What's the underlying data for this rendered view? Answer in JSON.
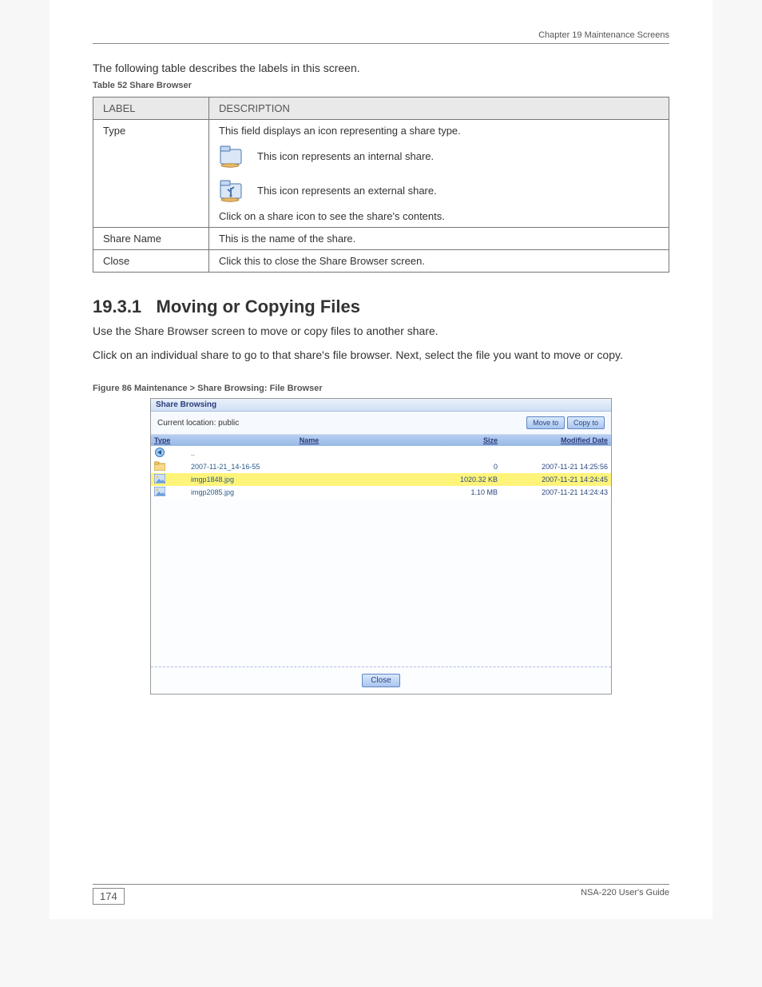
{
  "header": {
    "chapter": "Chapter 19 Maintenance Screens"
  },
  "intro_text": "The following table describes the labels in this screen.",
  "table1": {
    "caption": "Table 52   Share Browser",
    "headers": [
      "LABEL",
      "DESCRIPTION"
    ],
    "rows": [
      {
        "label": "Type",
        "desc_intro": "This field displays an icon representing a share type.",
        "icons": [
          {
            "name": "folder-share-icon",
            "text": "This icon represents an internal share."
          },
          {
            "name": "usb-folder-icon",
            "text": "This icon represents an external share."
          }
        ],
        "desc_outro": "Click on a share icon to see the share's contents."
      },
      {
        "label": "Share Name",
        "description": "This is the name of the share."
      },
      {
        "label": "Close",
        "description": "Click this to close the Share Browser screen."
      }
    ]
  },
  "section_num": "19.3.1",
  "section_title": "Moving or Copying Files",
  "body": [
    "Use the Share Browser screen to move or copy files to another share.",
    "Click on an individual share to go to that share's file browser. Next, select the file you want to move or copy."
  ],
  "figure_caption": "Figure 86   Maintenance > Share Browsing: File Browser",
  "share_browser": {
    "title": "Share Browsing",
    "location": "Current location: public",
    "buttons": {
      "move": "Move to",
      "copy": "Copy to",
      "close": "Close"
    },
    "columns": [
      "Type",
      "Name",
      "Size",
      "Modified Date"
    ],
    "rows": [
      {
        "name": "..",
        "size": "",
        "date": "",
        "type": "up",
        "highlight": false
      },
      {
        "name": "2007-11-21_14-16-55",
        "size": "0",
        "date": "2007-11-21 14:25:56",
        "type": "folder",
        "highlight": false
      },
      {
        "name": "imgp1848.jpg",
        "size": "1020.32 KB",
        "date": "2007-11-21 14:24:45",
        "type": "image",
        "highlight": true
      },
      {
        "name": "imgp2085.jpg",
        "size": "1.10 MB",
        "date": "2007-11-21 14:24:43",
        "type": "image",
        "highlight": false
      }
    ]
  },
  "footer": {
    "page": "174",
    "product": "NSA-220 User's Guide"
  }
}
